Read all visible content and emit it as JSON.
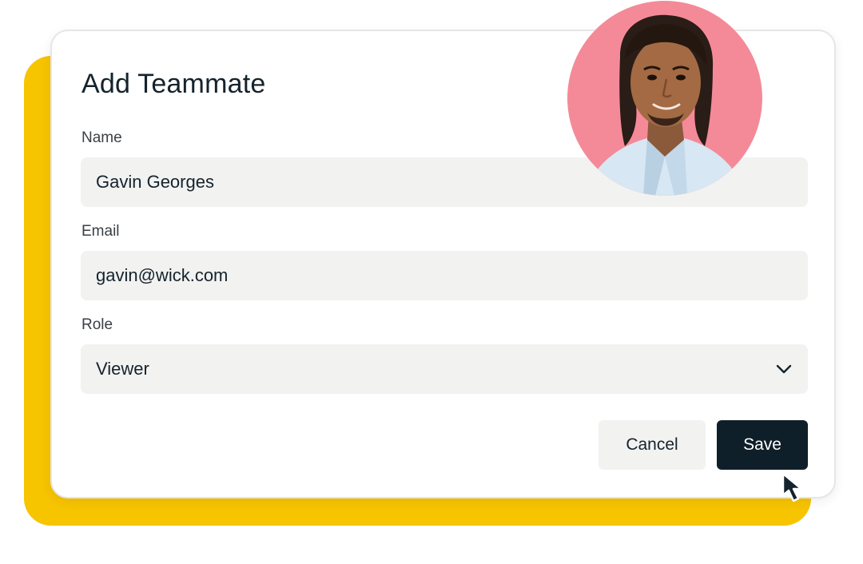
{
  "colors": {
    "accent_yellow": "#f7c400",
    "text_dark": "#14232d",
    "field_bg": "#f2f2f1",
    "save_bg": "#0f1f2a",
    "avatar_bg": "#f48a98"
  },
  "dialog": {
    "title": "Add Teammate",
    "fields": {
      "name": {
        "label": "Name",
        "value": "Gavin Georges"
      },
      "email": {
        "label": "Email",
        "value": "gavin@wick.com"
      },
      "role": {
        "label": "Role",
        "value": "Viewer",
        "icon": "chevron-down-icon"
      }
    },
    "buttons": {
      "cancel": "Cancel",
      "save": "Save"
    }
  },
  "avatar": {
    "icon": "user-portrait"
  },
  "cursor": {
    "icon": "mouse-pointer-icon"
  }
}
